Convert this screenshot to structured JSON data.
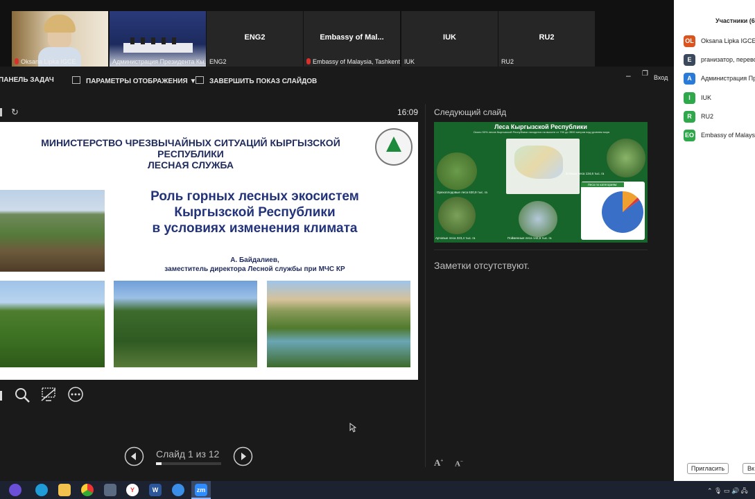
{
  "video_tiles": [
    {
      "caption": "Oksana Lipka IGCE",
      "muted": true,
      "big": ""
    },
    {
      "caption": "Администрация Президента Кы...",
      "muted": false,
      "big": ""
    },
    {
      "caption": "ENG2",
      "muted": false,
      "big": "ENG2"
    },
    {
      "caption": "Embassy of Malaysia, Tashkent",
      "muted": true,
      "big": "Embassy of Mal..."
    },
    {
      "caption": "IUK",
      "muted": false,
      "big": "IUK"
    },
    {
      "caption": "RU2",
      "muted": false,
      "big": "RU2"
    }
  ],
  "toolbar": {
    "taskbar_label": "ПАНЕЛЬ ЗАДАЧ",
    "display_settings_label": "ПАРАМЕТРЫ ОТОБРАЖЕНИЯ ▼",
    "end_show_label": "ЗАВЕРШИТЬ ПОКАЗ СЛАЙДОВ",
    "exit_label": "Вход"
  },
  "presenter": {
    "timer": "16:09",
    "next_slide_label": "Следующий слайд",
    "notes_text": "Заметки отсутствуют.",
    "slide_counter": "Слайд 1 из 12",
    "progress": 0.083
  },
  "slide": {
    "ministry_line1": "МИНИСТЕРСТВО ЧРЕЗВЫЧАЙНЫХ СИТУАЦИЙ КЫРГЫЗСКОЙ РЕСПУБЛИКИ",
    "ministry_line2": "ЛЕСНАЯ СЛУЖБА",
    "title_line1": "Роль горных лесных экосистем",
    "title_line2": "Кыргызской Республики",
    "title_line3": "в условиях изменения климата",
    "author_name": "А. Байдалиев,",
    "author_position": "заместитель директора Лесной службы при МЧС КР"
  },
  "next_slide": {
    "title": "Леса Кыргызской Республики",
    "subtitle": "Около 90% лесов Кыргызской Республики находятся на высоте от 700 до 3500 метров над уровнем моря",
    "label_spruce": "Еловые леса 134,6 тыс. га",
    "label_walnut": "Орехоплодовые леса 630,9 тыс. га",
    "label_juniper": "Арчовые леса 323,4 тыс. га",
    "label_floodplain": "Пойменные леса 142,6 тыс. га",
    "label_categories": "Леса по категориям:",
    "pie_values": [
      115426.9,
      22764.8,
      771296.9
    ],
    "pie_colors": [
      "#f0a030",
      "#d93a3a",
      "#3a6fc8"
    ]
  },
  "participants": {
    "header": "Участники (6)",
    "list": [
      {
        "initials": "OL",
        "name": "Oksana Lipka IGCE (",
        "color": "#d9541e"
      },
      {
        "initials": "E",
        "name": "рганизатор, перево",
        "color": "#3a4a5c"
      },
      {
        "initials": "A",
        "name": "Администрация Пре",
        "color": "#2a7bd8"
      },
      {
        "initials": "I",
        "name": "IUK",
        "color": "#2ea84a"
      },
      {
        "initials": "R",
        "name": "RU2",
        "color": "#2ea84a"
      },
      {
        "initials": "EO",
        "name": "Embassy of Malaysi",
        "color": "#2ea84a"
      }
    ],
    "invite_label": "Пригласить",
    "other_button_label": "Вк"
  },
  "taskbar": {
    "zoom_label": "zm",
    "word_label": "W",
    "yandex_label": "Y"
  }
}
